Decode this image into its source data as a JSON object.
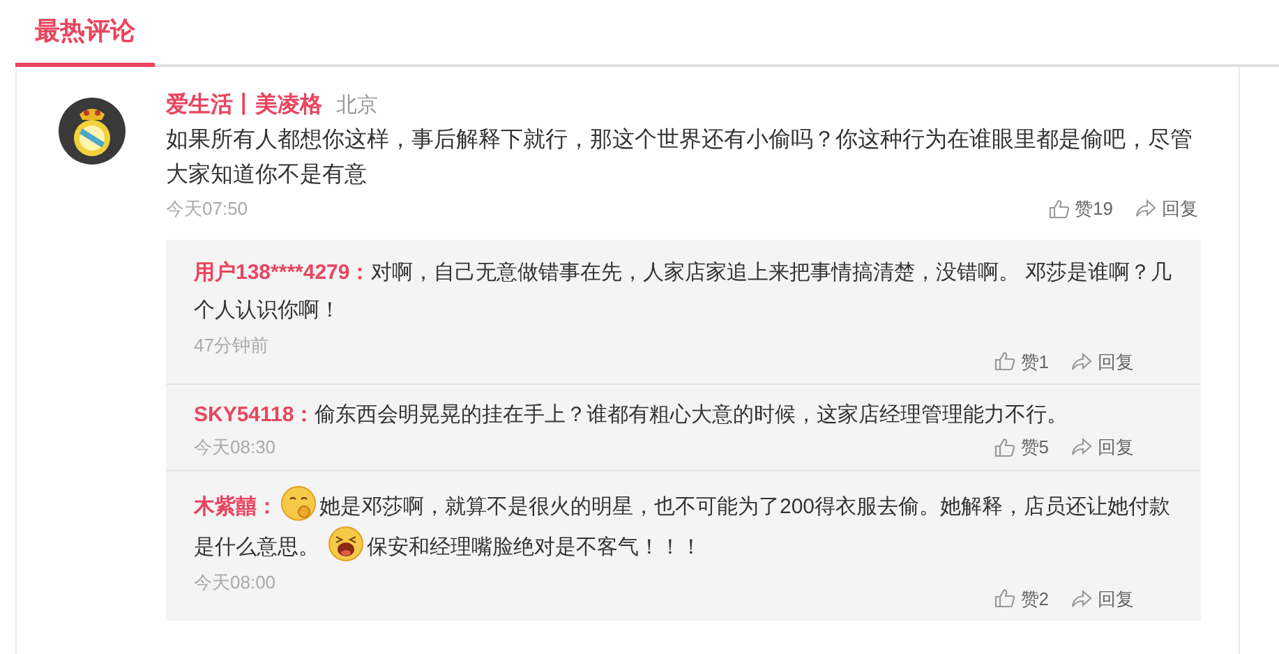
{
  "tabs": [
    {
      "label": "最热评论",
      "selected": true
    }
  ],
  "comment": {
    "author": "爱生活丨美凌格",
    "location": "北京",
    "body": "如果所有人都想你这样，事后解释下就行，那这个世界还有小偷吗？你这种行为在谁眼里都是偷吧，尽管大家知道你不是有意",
    "time": "今天07:50",
    "likes": "赞19",
    "reply_label": "回复",
    "replies": [
      {
        "author": "用户138****4279：",
        "body": [
          {
            "kind": "text",
            "text": "对啊，自己无意做错事在先，人家店家追上来把事情搞清楚，没错啊。  邓莎是谁啊？几个人认识你啊！"
          }
        ],
        "time": "47分钟前",
        "likes": "赞1",
        "reply_label": "回复"
      },
      {
        "author": "SKY54118：",
        "body": [
          {
            "kind": "text",
            "text": "偷东西会明晃晃的挂在手上？谁都有粗心大意的时候，这家店经理管理能力不行。"
          }
        ],
        "time": "今天08:30",
        "likes": "赞5",
        "reply_label": "回复"
      },
      {
        "author": "木紫囍：",
        "body": [
          {
            "kind": "emoji"
          },
          {
            "kind": "text",
            "text": "她是邓莎啊，就算不是很火的明星，也不可能为了200得衣服去偷。她解释，店员还让她付款是什么意思。 "
          },
          {
            "kind": "emoji"
          },
          {
            "kind": "text",
            "text": "保安和经理嘴脸绝对是不客气！！！"
          }
        ],
        "time": "今天08:00",
        "likes": "赞2",
        "reply_label": "回复"
      }
    ]
  }
}
